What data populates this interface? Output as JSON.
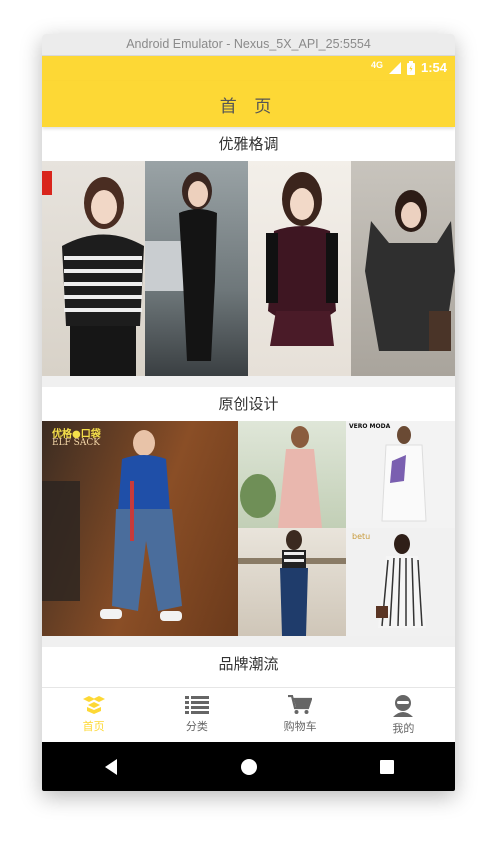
{
  "window": {
    "title": "Android Emulator - Nexus_5X_API_25:5554"
  },
  "status": {
    "network": "4G",
    "time": "1:54"
  },
  "appbar": {
    "title": "首 页"
  },
  "sections": [
    {
      "title": "优雅格调"
    },
    {
      "title": "原创设计"
    },
    {
      "title": "品牌潮流"
    }
  ],
  "brands": {
    "a": "优格●口袋",
    "b": "ELF SACK",
    "c": "VERO MODA",
    "d": "betu"
  },
  "nav": [
    {
      "label": "首页",
      "icon": "home-icon"
    },
    {
      "label": "分类",
      "icon": "list-icon"
    },
    {
      "label": "购物车",
      "icon": "cart-icon"
    },
    {
      "label": "我的",
      "icon": "profile-icon"
    }
  ],
  "colors": {
    "accent": "#fdd835",
    "nav_inactive": "#666666"
  }
}
